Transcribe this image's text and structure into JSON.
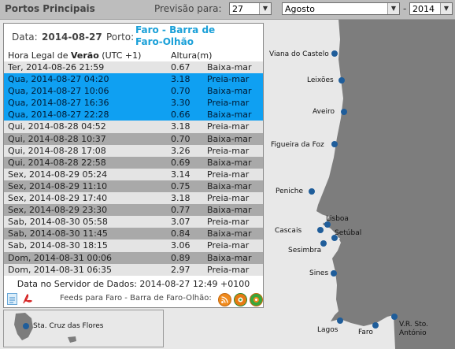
{
  "topbar": {
    "title": "Portos Principais",
    "previsao_label": "Previsão para:",
    "day": "27",
    "month": "Agosto",
    "year": "2014",
    "dash": "-"
  },
  "header": {
    "data_label": "Data:",
    "date": "2014-08-27",
    "porto_label": "Porto:",
    "port_line1": "Faro - Barra de",
    "port_line2": "Faro-Olhão"
  },
  "columns": {
    "time": "Hora Legal de",
    "time_bold": "Verão",
    "time_tz": "(UTC +1)",
    "height": "Altura(m)"
  },
  "rows": [
    {
      "time": "Ter, 2014-08-26 21:59",
      "height": "0.67",
      "type": "Baixa-mar",
      "style": "l"
    },
    {
      "time": "Qua, 2014-08-27 04:20",
      "height": "3.18",
      "type": "Preia-mar",
      "style": "h"
    },
    {
      "time": "Qua, 2014-08-27 10:06",
      "height": "0.70",
      "type": "Baixa-mar",
      "style": "h"
    },
    {
      "time": "Qua, 2014-08-27 16:36",
      "height": "3.30",
      "type": "Preia-mar",
      "style": "h"
    },
    {
      "time": "Qua, 2014-08-27 22:28",
      "height": "0.66",
      "type": "Baixa-mar",
      "style": "h"
    },
    {
      "time": "Qui, 2014-08-28 04:52",
      "height": "3.18",
      "type": "Preia-mar",
      "style": "l"
    },
    {
      "time": "Qui, 2014-08-28 10:37",
      "height": "0.70",
      "type": "Baixa-mar",
      "style": "d"
    },
    {
      "time": "Qui, 2014-08-28 17:08",
      "height": "3.26",
      "type": "Preia-mar",
      "style": "l"
    },
    {
      "time": "Qui, 2014-08-28 22:58",
      "height": "0.69",
      "type": "Baixa-mar",
      "style": "d"
    },
    {
      "time": "Sex, 2014-08-29 05:24",
      "height": "3.14",
      "type": "Preia-mar",
      "style": "l"
    },
    {
      "time": "Sex, 2014-08-29 11:10",
      "height": "0.75",
      "type": "Baixa-mar",
      "style": "d"
    },
    {
      "time": "Sex, 2014-08-29 17:40",
      "height": "3.18",
      "type": "Preia-mar",
      "style": "l"
    },
    {
      "time": "Sex, 2014-08-29 23:30",
      "height": "0.77",
      "type": "Baixa-mar",
      "style": "d"
    },
    {
      "time": "Sab, 2014-08-30 05:58",
      "height": "3.07",
      "type": "Preia-mar",
      "style": "l"
    },
    {
      "time": "Sab, 2014-08-30 11:45",
      "height": "0.84",
      "type": "Baixa-mar",
      "style": "d"
    },
    {
      "time": "Sab, 2014-08-30 18:15",
      "height": "3.06",
      "type": "Preia-mar",
      "style": "l"
    },
    {
      "time": "Dom, 2014-08-31 00:06",
      "height": "0.89",
      "type": "Baixa-mar",
      "style": "d"
    },
    {
      "time": "Dom, 2014-08-31 06:35",
      "height": "2.97",
      "type": "Preia-mar",
      "style": "l"
    }
  ],
  "server": "Data no Servidor de Dados: 2014-08-27 12:49 +0100",
  "footer": {
    "feeds_text": "Feeds para Faro - Barra de Faro-Olhão:",
    "icons": [
      "document-icon",
      "pdf-icon",
      "rss-feed-icon",
      "rss-feed-icon",
      "rss-feed-icon"
    ]
  },
  "map": {
    "ports": [
      "Viana do Castelo",
      "Leixões",
      "Aveiro",
      "Figueira da Foz",
      "Peniche",
      "Lisboa",
      "Cascais",
      "Setúbal",
      "Sesimbra",
      "Sines",
      "Lagos",
      "Faro",
      "V.R. Sto.",
      "António",
      "Sta. Cruz das Flores"
    ]
  },
  "colors": {
    "highlight_row": "#0fa0f2",
    "light_row": "#e4e4e4",
    "dark_row": "#a9a9a9",
    "port_name": "#1aa0d8",
    "land": "#7d7d7d",
    "sea": "#e8e8e8",
    "port_dot": "#1f5d9a"
  }
}
